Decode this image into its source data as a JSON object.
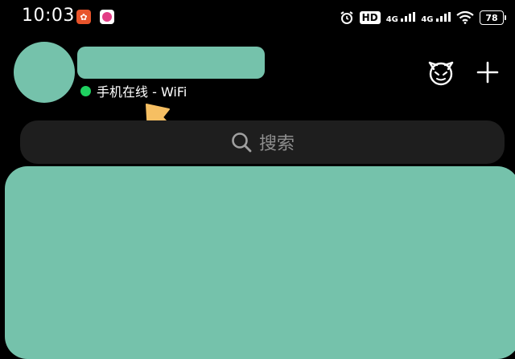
{
  "status_bar": {
    "time": "10:03",
    "hd_label": "HD",
    "network_1": "4G",
    "network_2": "4G",
    "battery": "78"
  },
  "profile": {
    "online_status": "手机在线 - WiFi",
    "online_color": "#1fd160",
    "placeholder_color": "#75c2ab"
  },
  "search": {
    "placeholder": "搜索"
  },
  "annotation": {
    "arrow_color": "#f6bf62"
  }
}
